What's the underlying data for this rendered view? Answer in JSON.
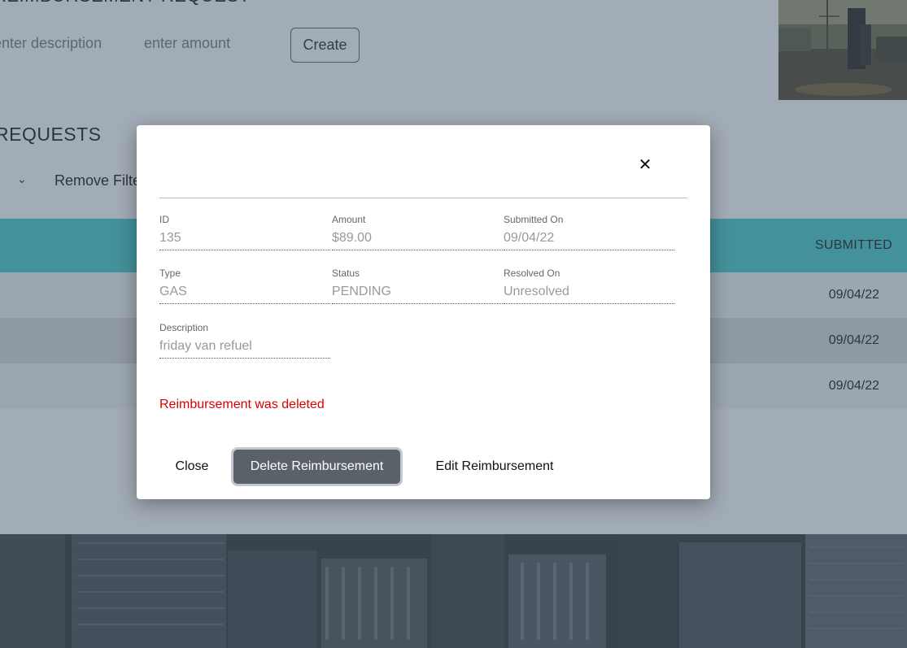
{
  "background": {
    "request_title": "REIMBURSEMENT REQUEST",
    "description_placeholder": "enter description",
    "amount_placeholder": "enter amount",
    "create_label": "Create",
    "requests_title": "REQUESTS",
    "remove_filter_label": "Remove Filter",
    "table": {
      "submitted_header": "SUBMITTED",
      "rows": [
        {
          "submitted": "09/04/22"
        },
        {
          "submitted": "09/04/22"
        },
        {
          "submitted": "09/04/22"
        }
      ]
    }
  },
  "modal": {
    "fields": {
      "id": {
        "label": "ID",
        "value": "135"
      },
      "amount": {
        "label": "Amount",
        "value": "$89.00"
      },
      "submitted_on": {
        "label": "Submitted On",
        "value": "09/04/22"
      },
      "type": {
        "label": "Type",
        "value": "GAS"
      },
      "status": {
        "label": "Status",
        "value": "PENDING"
      },
      "resolved_on": {
        "label": "Resolved On",
        "value": "Unresolved"
      },
      "description": {
        "label": "Description",
        "value": "friday van refuel"
      }
    },
    "message": "Reimbursement was deleted",
    "buttons": {
      "close": "Close",
      "delete": "Delete Reimbursement",
      "edit": "Edit Reimbursement"
    },
    "close_icon": "✕"
  },
  "colors": {
    "table_header": "#40c9c9",
    "error": "#d80000",
    "delete_button": "#5b6168"
  }
}
